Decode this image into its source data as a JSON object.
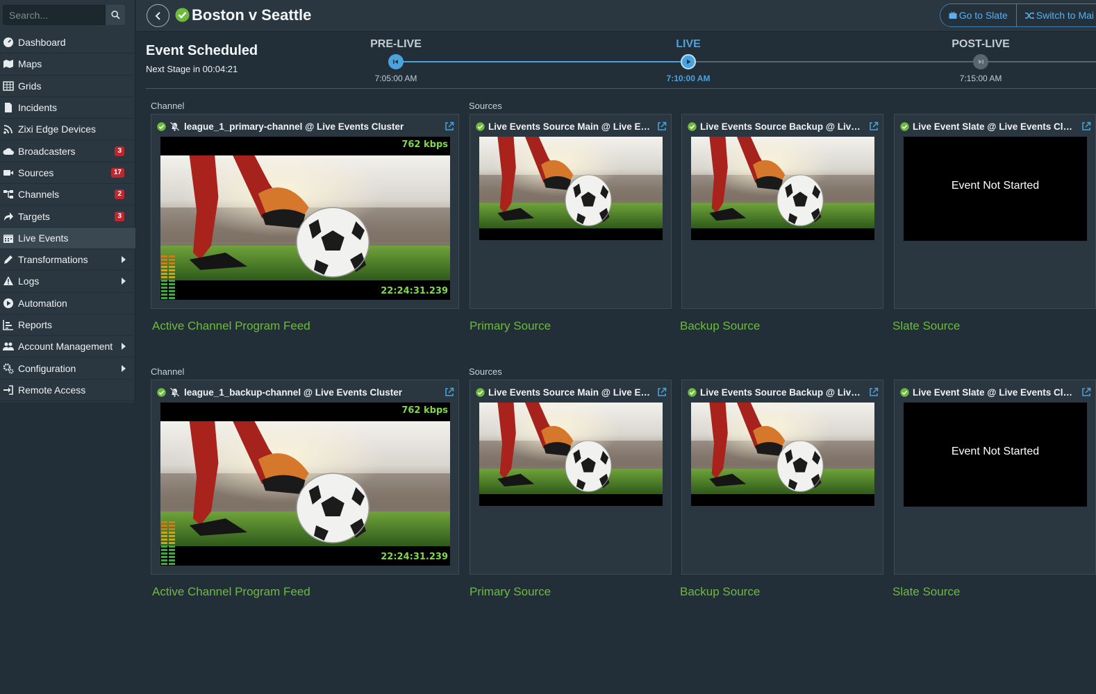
{
  "sidebar": {
    "search_placeholder": "Search...",
    "items": [
      {
        "label": "Dashboard",
        "icon": "dashboard-icon"
      },
      {
        "label": "Maps",
        "icon": "map-icon"
      },
      {
        "label": "Grids",
        "icon": "grid-icon"
      },
      {
        "label": "Incidents",
        "icon": "document-icon"
      },
      {
        "label": "Zixi Edge Devices",
        "icon": "rss-icon"
      },
      {
        "label": "Broadcasters",
        "icon": "cloud-icon",
        "badge": "3"
      },
      {
        "label": "Sources",
        "icon": "video-camera-icon",
        "badge": "17"
      },
      {
        "label": "Channels",
        "icon": "sitemap-icon",
        "badge": "2"
      },
      {
        "label": "Targets",
        "icon": "share-icon",
        "badge": "3"
      },
      {
        "label": "Live Events",
        "icon": "calendar-icon",
        "active": true
      },
      {
        "label": "Transformations",
        "icon": "pencil-icon",
        "submenu": true
      },
      {
        "label": "Logs",
        "icon": "warning-icon",
        "submenu": true
      },
      {
        "label": "Automation",
        "icon": "play-circle-icon"
      },
      {
        "label": "Reports",
        "icon": "bar-chart-icon"
      },
      {
        "label": "Account Management",
        "icon": "users-icon",
        "submenu": true
      },
      {
        "label": "Configuration",
        "icon": "cogs-icon",
        "submenu": true
      },
      {
        "label": "Remote Access",
        "icon": "sign-in-icon"
      }
    ]
  },
  "header": {
    "title": "Boston v Seattle",
    "go_to_slate": "Go to Slate",
    "switch_to": "Switch to Mai"
  },
  "stage": {
    "title": "Event Scheduled",
    "next_stage": "Next Stage in 00:04:21",
    "steps": [
      {
        "label": "PRE-LIVE",
        "time": "7:05:00 AM"
      },
      {
        "label": "LIVE",
        "time": "7:10:00 AM"
      },
      {
        "label": "POST-LIVE",
        "time": "7:15:00 AM"
      }
    ]
  },
  "rows": [
    {
      "channel_label": "Channel",
      "sources_label": "Sources",
      "channel": {
        "title": "league_1_primary-channel @ Live Events Cluster",
        "bitrate": "762 kbps",
        "timecode": "22:24:31.239",
        "feed": "Active Channel Program Feed"
      },
      "sources": [
        {
          "title": "Live Events Source Main @ Live Events Cluster",
          "feed": "Primary Source"
        },
        {
          "title": "Live Events Source Backup @ Live Events Cluster",
          "feed": "Backup Source"
        },
        {
          "title": "Live Event Slate @ Live Events Cluster",
          "feed": "Slate Source",
          "status": "Event Not Started"
        }
      ]
    },
    {
      "channel_label": "Channel",
      "sources_label": "Sources",
      "channel": {
        "title": "league_1_backup-channel @ Live Events Cluster",
        "bitrate": "762 kbps",
        "timecode": "22:24:31.239",
        "feed": "Active Channel Program Feed"
      },
      "sources": [
        {
          "title": "Live Events Source Main @ Live Events Cluster",
          "feed": "Primary Source"
        },
        {
          "title": "Live Events Source Backup @ Live Events Cluster",
          "feed": "Backup Source"
        },
        {
          "title": "Live Event Slate @ Live Events Cluster",
          "feed": "Slate Source",
          "status": "Event Not Started"
        }
      ]
    }
  ],
  "colors": {
    "accent": "#4aa3df",
    "success": "#6dbb3c",
    "badge": "#c0262d",
    "background": "#232f38"
  }
}
